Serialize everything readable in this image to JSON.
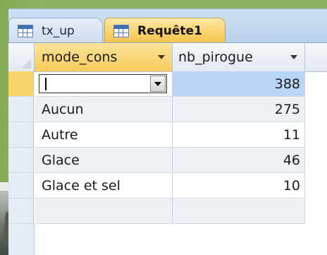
{
  "tabs": [
    {
      "label": "tx_up",
      "active": false
    },
    {
      "label": "Requête1",
      "active": true
    }
  ],
  "columns": [
    {
      "label": "mode_cons",
      "sortable_dropdown": true
    },
    {
      "label": "nb_pirogue",
      "sortable_dropdown": true
    }
  ],
  "rows": [
    {
      "mode_cons": "",
      "nb_pirogue": "388",
      "editing": true
    },
    {
      "mode_cons": "Aucun",
      "nb_pirogue": "275"
    },
    {
      "mode_cons": "Autre",
      "nb_pirogue": "11"
    },
    {
      "mode_cons": "Glace",
      "nb_pirogue": "46"
    },
    {
      "mode_cons": "Glace et sel",
      "nb_pirogue": "10"
    }
  ],
  "colors": {
    "background_green": "#8fb25e",
    "active_tab": "#f9d46f",
    "selected_value_cell": "#b9d6f6"
  }
}
